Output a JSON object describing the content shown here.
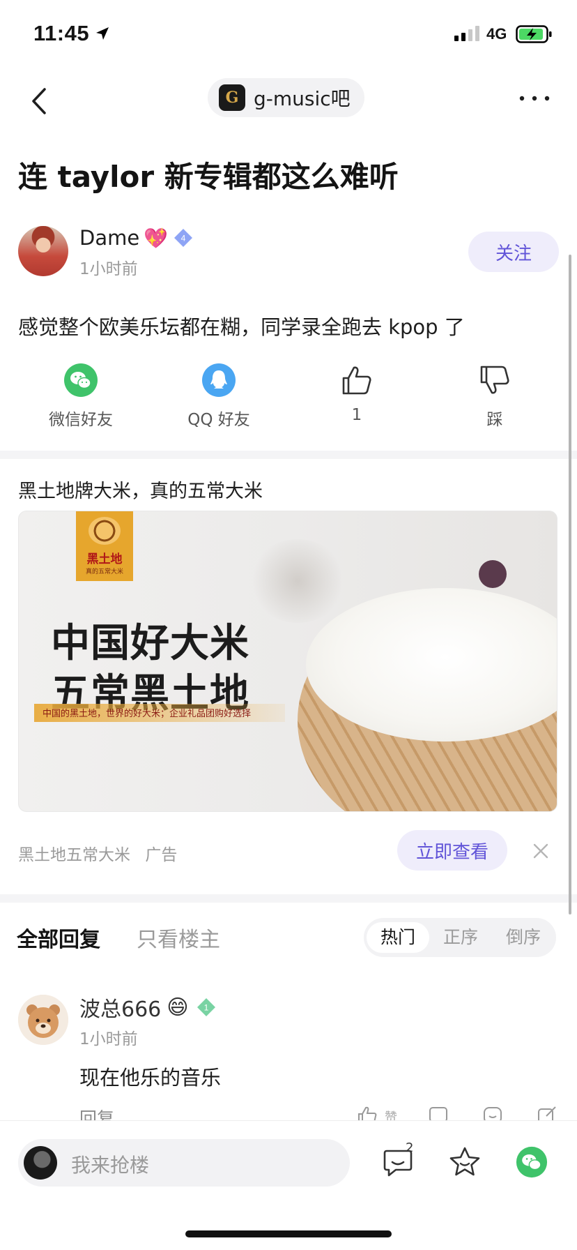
{
  "status_bar": {
    "time": "11:45",
    "network": "4G"
  },
  "nav": {
    "forum_logo": "G",
    "forum_name": "g-music吧"
  },
  "post": {
    "title": "连 taylor 新专辑都这么难听",
    "author": {
      "name": "Dame",
      "level": "4",
      "time_ago": "1小时前",
      "follow_label": "关注"
    },
    "content": "感觉整个欧美乐坛都在糊，同学录全跑去 kpop 了",
    "actions": {
      "wechat": "微信好友",
      "qq": "QQ 好友",
      "like_count": "1",
      "dislike": "踩"
    }
  },
  "ad": {
    "title": "黑土地牌大米，真的五常大米",
    "image": {
      "brand": "黑土地",
      "brand_sub": "真的五常大米",
      "headline1": "中国好大米",
      "headline2": "五常黑土地",
      "slogan": "中国的黑土地，世界的好大米；企业礼品团购好选择"
    },
    "advertiser": "黑土地五常大米",
    "tag": "广告",
    "cta": "立即查看"
  },
  "replies": {
    "tab_all": "全部回复",
    "tab_owner": "只看楼主",
    "sort": [
      "热门",
      "正序",
      "倒序"
    ],
    "comments": [
      {
        "name": "波总666",
        "emoji": "😄",
        "level": "1",
        "time_ago": "1小时前",
        "text": "现在他乐的音乐",
        "reply_label": "回复",
        "like_label": "赞"
      }
    ]
  },
  "bottom_bar": {
    "placeholder": "我来抢楼",
    "comment_count": "2"
  },
  "colors": {
    "accent": "#6154d8",
    "accent_bg": "#efedfb",
    "wechat": "#3fc36a",
    "qq": "#4aa6f2"
  }
}
